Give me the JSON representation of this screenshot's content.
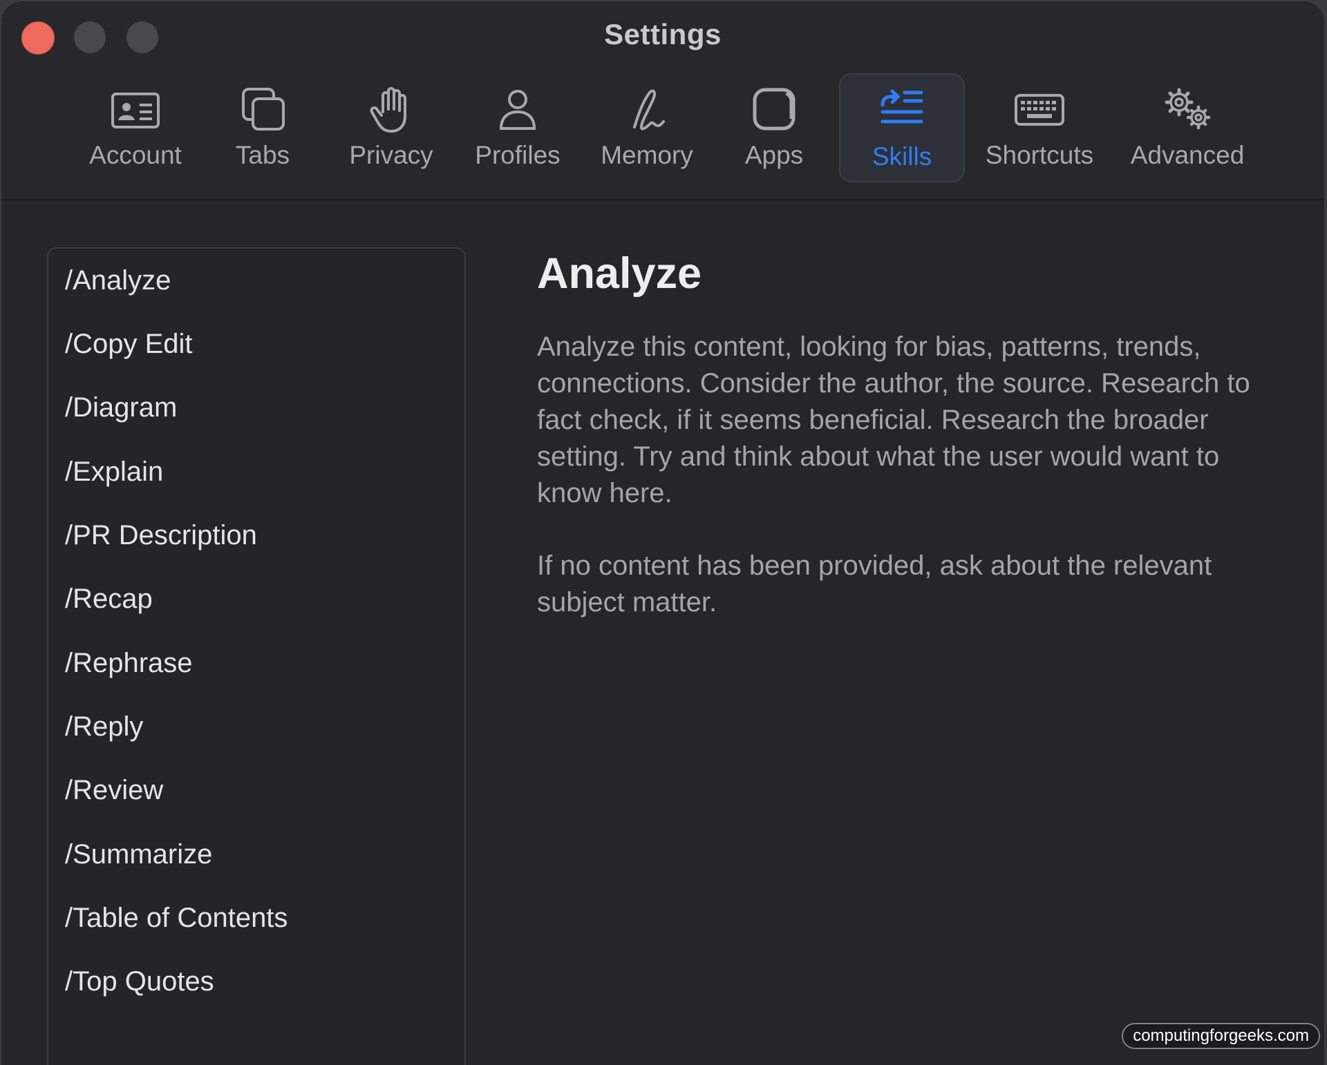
{
  "window": {
    "title": "Settings"
  },
  "toolbar": {
    "selected": "Skills",
    "items": [
      {
        "label": "Account",
        "icon": "person-card-icon"
      },
      {
        "label": "Tabs",
        "icon": "tabs-icon"
      },
      {
        "label": "Privacy",
        "icon": "hand-icon"
      },
      {
        "label": "Profiles",
        "icon": "person-icon"
      },
      {
        "label": "Memory",
        "icon": "signature-icon"
      },
      {
        "label": "Apps",
        "icon": "app-square-icon"
      },
      {
        "label": "Skills",
        "icon": "list-arrow-icon"
      },
      {
        "label": "Shortcuts",
        "icon": "keyboard-icon"
      },
      {
        "label": "Advanced",
        "icon": "gears-icon"
      }
    ]
  },
  "skills": {
    "items": [
      "/Analyze",
      "/Copy Edit",
      "/Diagram",
      "/Explain",
      "/PR Description",
      "/Recap",
      "/Rephrase",
      "/Reply",
      "/Review",
      "/Summarize",
      "/Table of Contents",
      "/Top Quotes"
    ]
  },
  "detail": {
    "title": "Analyze",
    "paragraphs": [
      "Analyze this content, looking for bias, patterns, trends, connections. Consider the author, the source. Research to fact check, if it seems beneficial. Research the broader setting. Try and think about what the user would want to know here.",
      "If no content has been provided, ask about the relevant subject matter."
    ]
  },
  "watermark": "computingforgeeks.com",
  "colors": {
    "accent": "#2f7cf6",
    "window_bg": "#24262a",
    "close_button": "#ec6a5e"
  }
}
